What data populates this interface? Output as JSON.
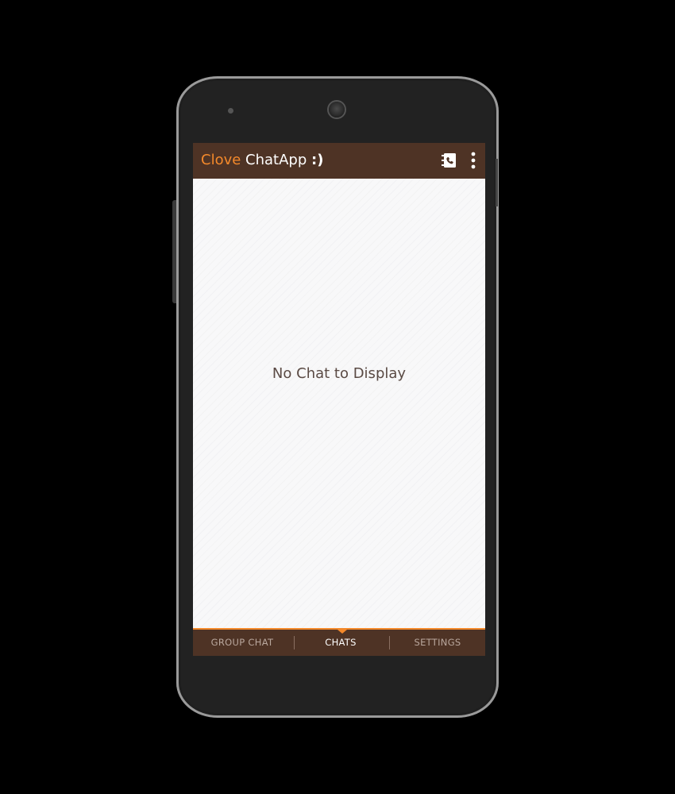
{
  "app": {
    "title_accent": "Clove",
    "title_main": "ChatApp",
    "title_smiley": ":)"
  },
  "action_bar": {
    "icons": [
      "contacts-icon",
      "overflow-menu-icon"
    ]
  },
  "content": {
    "empty_message": "No Chat to Display"
  },
  "tabs": [
    {
      "label": "GROUP CHAT",
      "active": false
    },
    {
      "label": "CHATS",
      "active": true
    },
    {
      "label": "SETTINGS",
      "active": false
    }
  ],
  "colors": {
    "action_bar": "#4e3325",
    "accent": "#f4892b",
    "empty_text": "#5a4a44",
    "inactive_tab": "#b9a79d"
  }
}
